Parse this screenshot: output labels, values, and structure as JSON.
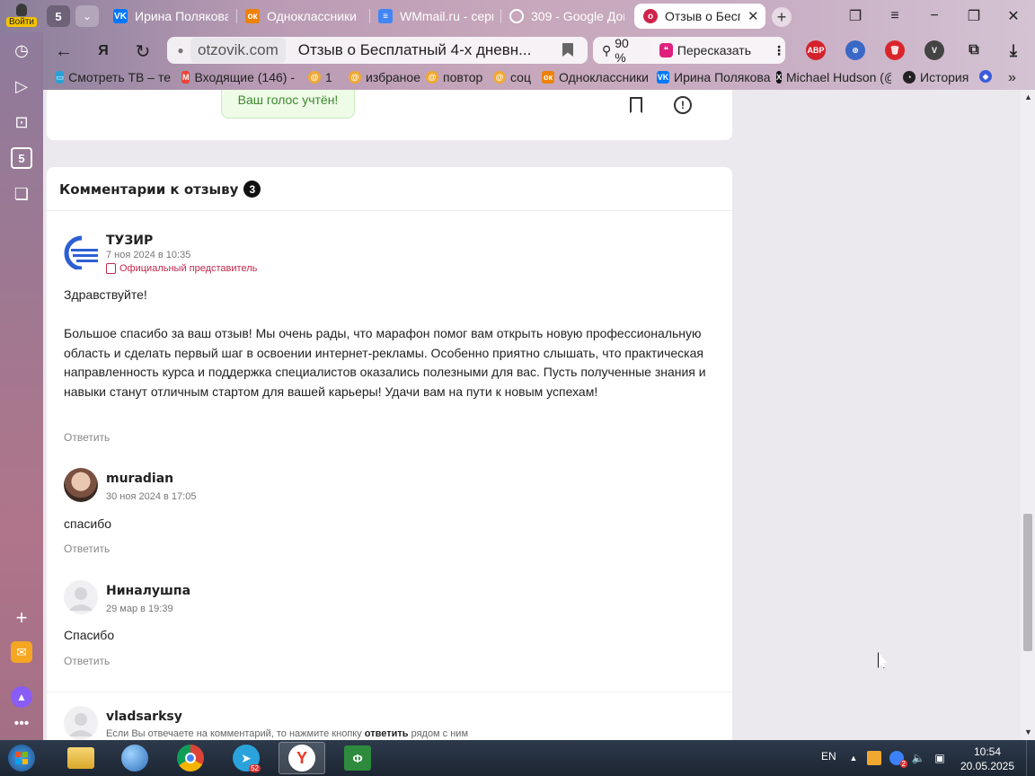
{
  "sidebar": {
    "login_label": "Войти",
    "buttons": [
      "history-icon",
      "play-icon",
      "camera-icon",
      "five-icon",
      "collections-icon"
    ],
    "bottom": [
      "add-icon",
      "mail-icon",
      "alice-icon",
      "more-icon"
    ]
  },
  "tabs": {
    "count_badge": "5",
    "items": [
      {
        "label": "Ирина Полякова",
        "icon": "vk",
        "color": "#0077ff"
      },
      {
        "label": "Одноклассники",
        "icon": "ok",
        "color": "#ee8208"
      },
      {
        "label": "WMmail.ru - серв",
        "icon": "doc",
        "color": "#4285f4"
      },
      {
        "label": "309 - Google Док",
        "icon": "circle",
        "color": "#555555"
      },
      {
        "label": "Отзыв о Беспл",
        "icon": "otzovik",
        "color": "#d0234a"
      }
    ]
  },
  "addressbar": {
    "domain": "otzovik.com",
    "title": "Отзыв о Бесплатный 4-х дневн...",
    "zoom": "90 %",
    "retell": "Пересказать"
  },
  "extensions": {
    "abp": "ABP",
    "abp_color": "#d4212b"
  },
  "bookmarks": [
    {
      "label": "Смотреть ТВ – те",
      "icon": "tv"
    },
    {
      "label": "Входящие (146) -",
      "icon": "gmail"
    },
    {
      "label": "1",
      "icon": "folder"
    },
    {
      "label": "избраное",
      "icon": "folder"
    },
    {
      "label": "повтор",
      "icon": "folder"
    },
    {
      "label": "соц",
      "icon": "folder"
    },
    {
      "label": "Одноклассники",
      "icon": "ok"
    },
    {
      "label": "Ирина Полякова",
      "icon": "vk"
    },
    {
      "label": "Michael Hudson (@",
      "icon": "x"
    },
    {
      "label": "История",
      "icon": "history"
    }
  ],
  "vote": {
    "label": "Ваш голос учтён!"
  },
  "comments_section": {
    "title": "Комментарии к отзыву",
    "count": "3",
    "reply_label": "Ответить",
    "items": [
      {
        "author": "ТУЗИР",
        "date": "7 ноя 2024 в 10:35",
        "badge": "Официальный представитель",
        "greeting": "Здравствуйте!",
        "text": "Большое спасибо за ваш отзыв! Мы очень рады, что марафон помог вам открыть новую профессиональную область и сделать первый шаг в освоении интернет-рекламы. Особенно приятно слышать, что практическая направленность курса и поддержка специалистов оказались полезными для вас. Пусть полученные знания и навыки станут отличным стартом для вашей карьеры! Удачи вам на пути к новым успехам!",
        "reply": "Ответить"
      },
      {
        "author": "muradian",
        "date": "30 ноя 2024 в 17:05",
        "text": "спасибо",
        "reply": "Ответить"
      },
      {
        "author": "Ниналушпа",
        "date": "29 мар в 19:39",
        "text": "Спасибо",
        "reply": "Ответить"
      }
    ],
    "new_comment_user": "vladsarksy",
    "hint_before": "Если Вы отвечаете на комментарий, то нажмите кнопку ",
    "hint_link": "ответить",
    "hint_after": " рядом с ним"
  },
  "taskbar": {
    "lang": "EN",
    "time": "10:54",
    "date": "20.05.2025",
    "telegram_badge": "52",
    "tray_badge": "2"
  }
}
